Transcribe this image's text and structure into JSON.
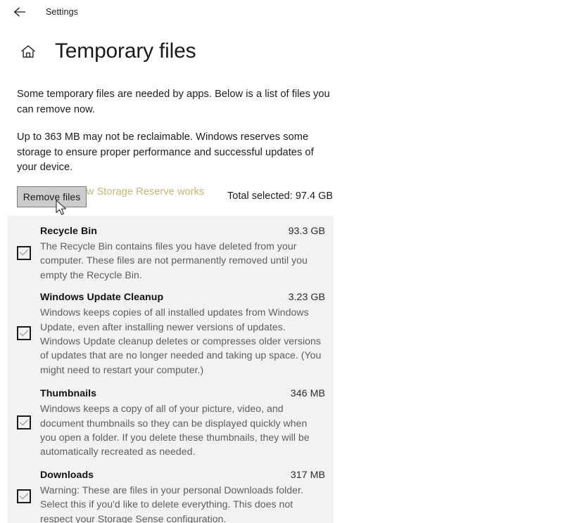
{
  "titlebar": {
    "back_icon": "back-arrow-icon",
    "label": "Settings"
  },
  "header": {
    "home_icon": "home-icon",
    "title": "Temporary files"
  },
  "content": {
    "paragraph_1": "Some temporary files are needed by apps. Below is a list of files you can remove now.",
    "paragraph_2": "Up to 363 MB may not be reclaimable. Windows reserves some storage to ensure proper performance and successful updates of your device.",
    "link_text": "Learn about how Storage Reserve works",
    "link_color": "#c3b873"
  },
  "actions": {
    "remove_button_label": "Remove files",
    "remove_button_state": "hover",
    "total_selected_label": "Total selected: 97.4 GB"
  },
  "file_list": {
    "panel_background": "#f2f2f2",
    "items": [
      {
        "name": "Recycle Bin",
        "size": "93.3 GB",
        "description": "The Recycle Bin contains files you have deleted from your computer. These files are not permanently removed until you empty the Recycle Bin.",
        "checked": true,
        "checkbox_icon": "checkmark-icon"
      },
      {
        "name": "Windows Update Cleanup",
        "size": "3.23 GB",
        "description": "Windows keeps copies of all installed updates from Windows Update, even after installing newer versions of updates. Windows Update cleanup deletes or compresses older versions of updates that are no longer needed and taking up space. (You might need to restart your computer.)",
        "checked": true,
        "checkbox_icon": "checkmark-icon"
      },
      {
        "name": "Thumbnails",
        "size": "346 MB",
        "description": "Windows keeps a copy of all of your picture, video, and document thumbnails so they can be displayed quickly when you open a folder. If you delete these thumbnails, they will be automatically recreated as needed.",
        "checked": true,
        "checkbox_icon": "checkmark-icon"
      },
      {
        "name": "Downloads",
        "size": "317 MB",
        "description": "Warning: These are files in your personal Downloads folder. Select this if you'd like to delete everything. This does not respect your Storage Sense configuration.",
        "checked": true,
        "checkbox_icon": "checkmark-icon"
      }
    ]
  },
  "pointer": {
    "icon": "mouse-arrow-cursor"
  }
}
